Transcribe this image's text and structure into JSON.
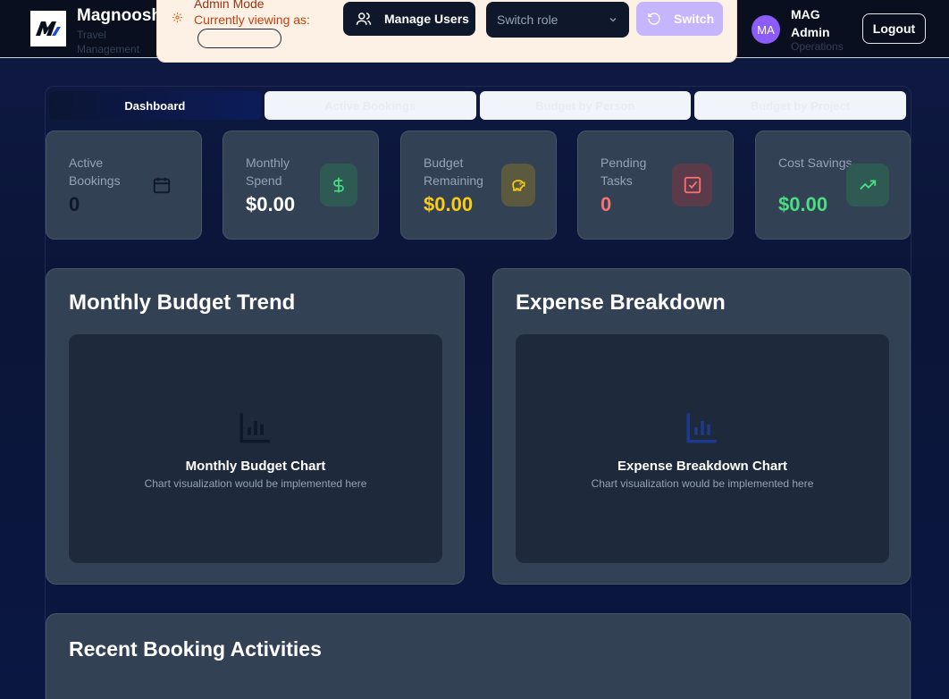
{
  "header": {
    "brand_name": "Magnoosh",
    "brand_sub": "Travel Management",
    "admin_mode_title": "Admin Mode",
    "viewing_as_label": "Currently viewing as:",
    "manage_users_label": "Manage Users",
    "switch_role_placeholder": "Switch role",
    "switch_label": "Switch",
    "avatar_initials": "MA",
    "user_name": "MAG Admin",
    "user_role": "Operations",
    "logout_label": "Logout"
  },
  "tabs": [
    {
      "label": "Dashboard",
      "active": true
    },
    {
      "label": "Active Bookings",
      "active": false
    },
    {
      "label": "Budget by Person",
      "active": false
    },
    {
      "label": "Budget by Project",
      "active": false
    }
  ],
  "stats": [
    {
      "label": "Active Bookings",
      "value": "0",
      "value_color": "#0f172a",
      "icon": "calendar-icon",
      "icon_bg": "transparent",
      "icon_color": "#0f172a"
    },
    {
      "label": "Monthly Spend",
      "value": "$0.00",
      "value_color": "#ffffff",
      "icon": "dollar-icon",
      "icon_bg": "#2f5a53",
      "icon_color": "#4ade80"
    },
    {
      "label": "Budget Remaining",
      "value": "$0.00",
      "value_color": "#facc15",
      "icon": "piggy-bank-icon",
      "icon_bg": "#5b5a3e",
      "icon_color": "#facc15"
    },
    {
      "label": "Pending Tasks",
      "value": "0",
      "value_color": "#f87171",
      "icon": "check-square-icon",
      "icon_bg": "#5b3b4a",
      "icon_color": "#f87171"
    },
    {
      "label": "Cost Savings",
      "value": "$0.00",
      "value_color": "#4ade80",
      "icon": "trending-up-icon",
      "icon_bg": "#2f5a53",
      "icon_color": "#4ade80"
    }
  ],
  "panels": {
    "budget_trend": {
      "title": "Monthly Budget Trend",
      "placeholder_title": "Monthly Budget Chart",
      "placeholder_sub": "Chart visualization would be implemented here",
      "icon_color": "#0f172a"
    },
    "expense_breakdown": {
      "title": "Expense Breakdown",
      "placeholder_title": "Expense Breakdown Chart",
      "placeholder_sub": "Chart visualization would be implemented here",
      "icon_color": "#1e3a8a"
    }
  },
  "recent": {
    "title": "Recent Booking Activities"
  }
}
